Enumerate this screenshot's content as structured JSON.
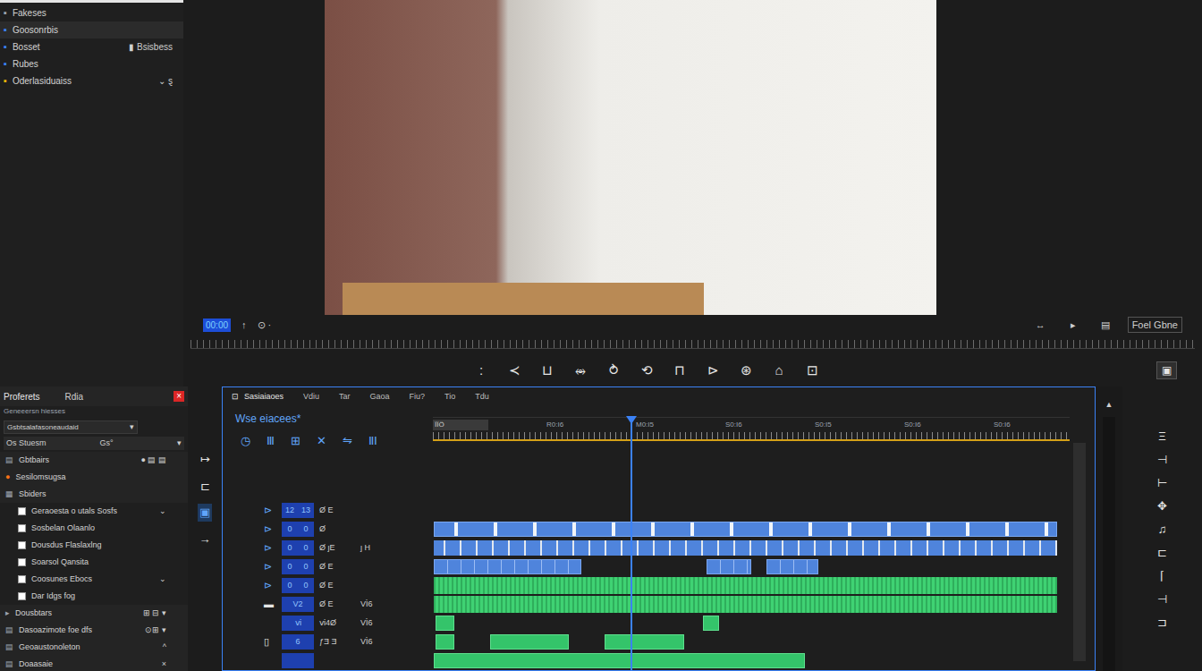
{
  "media_panel": {
    "items": [
      {
        "label": "Fakeses",
        "icon": "▪",
        "secondary": "",
        "color": "#9ca3af",
        "selected": false
      },
      {
        "label": "Goosonrbis",
        "icon": "▪",
        "secondary": "",
        "color": "#3b82f6",
        "selected": true
      },
      {
        "label": "Bosset",
        "icon": "▪",
        "secondary": "▮ Bsisbess",
        "color": "#3b82f6",
        "selected": false
      },
      {
        "label": "Rubes",
        "icon": "▪",
        "secondary": "",
        "color": "#3b82f6",
        "selected": false
      },
      {
        "label": "Oderlasiduaiss",
        "icon": "▪",
        "secondary": "⌄ ȿ",
        "color": "#eab308",
        "selected": false
      }
    ]
  },
  "viewer": {
    "timecode": "00:00",
    "tools": [
      "↑",
      "⊙ ·"
    ],
    "right_icons": [
      "↔",
      "▸",
      "▤"
    ],
    "fit": "Foel Gbne",
    "transport": [
      ":",
      "≺",
      "⊔",
      "⥈",
      "⥁",
      "⟲",
      "⊓",
      "⊳",
      "⊛",
      "⌂",
      "⊡"
    ],
    "end_button": "▣"
  },
  "project_panel": {
    "title": "Proferets",
    "tab": "Rdia",
    "close": "×",
    "subtitle": "Geneeersn hiesses",
    "dropdown": {
      "value": "Gsbtsalafasoneaudaid",
      "arrow": "▾"
    },
    "select_row": {
      "label": "Os Stuesm",
      "value": "Gs°",
      "arrow": "▾"
    },
    "rows": [
      {
        "kind": "row",
        "icon": "▤",
        "label": "Gbtbairs",
        "right": "● ▤ ▤",
        "color": "#9ca3af"
      },
      {
        "kind": "row",
        "icon": "●",
        "label": "Sesilomsugsa",
        "right": "",
        "color": "#f97316"
      },
      {
        "kind": "row",
        "icon": "▦",
        "label": "Sbiders",
        "right": "",
        "color": "#9ca3af"
      },
      {
        "kind": "check",
        "label": "Geraoesta o utals Sosfs",
        "checked": false,
        "right": "⌄"
      },
      {
        "kind": "check",
        "label": "Sosbelan Olaanlo",
        "checked": false,
        "right": ""
      },
      {
        "kind": "check",
        "label": "Dousdus Flaslaxlng",
        "checked": false,
        "right": ""
      },
      {
        "kind": "check",
        "label": "Soarsol Qansita",
        "checked": false,
        "right": ""
      },
      {
        "kind": "check",
        "label": "Coosunes Ebocs",
        "checked": false,
        "right": "⌄"
      },
      {
        "kind": "check",
        "label": "Dar Idgs fog",
        "checked": false,
        "right": ""
      },
      {
        "kind": "row",
        "icon": "▸",
        "label": "Dousbtars",
        "right": "⊞ ⊟ ▾",
        "color": "#9ca3af"
      },
      {
        "kind": "row",
        "icon": "▤",
        "label": "Dasoazimote foe dfs",
        "right": "⊙⊞ ▾",
        "color": "#9ca3af"
      },
      {
        "kind": "row",
        "icon": "▤",
        "label": "Geoaustonoleton",
        "right": "^",
        "color": "#9ca3af"
      },
      {
        "kind": "row",
        "icon": "▤",
        "label": "Doaasaie",
        "right": "×",
        "color": "#9ca3af"
      }
    ]
  },
  "tool_strip": [
    {
      "glyph": "↦",
      "selected": false
    },
    {
      "glyph": "⊏",
      "selected": false
    },
    {
      "glyph": "▣",
      "selected": true
    },
    {
      "glyph": "→",
      "selected": false
    }
  ],
  "timeline": {
    "tab_icon": "⊡",
    "tabs": [
      {
        "label": "Sasiaiaoes",
        "selected": true
      },
      {
        "label": "Vdiu",
        "selected": false
      },
      {
        "label": "Tar",
        "selected": false
      },
      {
        "label": "Gaoa",
        "selected": false
      },
      {
        "label": "Fiu?",
        "selected": false
      },
      {
        "label": "Tio",
        "selected": false
      },
      {
        "label": "Tdu",
        "selected": false
      }
    ],
    "sequence": "Wse eiacees*",
    "tools": [
      "◷",
      "Ⅲ",
      "⊞",
      "✕",
      "⇋",
      "ⅡⅠ"
    ],
    "ruler_labels": [
      "ÏÏÖ",
      "R0:I6",
      "M0:I5",
      "S0:I6",
      "S0:I5",
      "S0:I6",
      "S0:I6"
    ],
    "playhead": {
      "level": 0.31
    },
    "tracks": [
      {
        "toggle": "⊳",
        "cells": [
          "12",
          "13"
        ],
        "label": "Ø E",
        "extra": "",
        "clips": []
      },
      {
        "toggle": "⊳",
        "cells": [
          "0",
          "0"
        ],
        "label": "Ø",
        "extra": "",
        "clips": [
          {
            "kind": "video-markers",
            "start": 0.1,
            "end": 98
          }
        ]
      },
      {
        "toggle": "⊳",
        "cells": [
          "0",
          "0"
        ],
        "label": "Ø ȷE",
        "extra": "ȷ H",
        "clips": [
          {
            "kind": "video-segmented",
            "start": 0.1,
            "end": 98
          }
        ]
      },
      {
        "toggle": "⊳",
        "cells": [
          "0",
          "0"
        ],
        "label": "Ø E",
        "extra": "",
        "clips": [
          {
            "kind": "video",
            "start": 0.1,
            "end": 23.3
          },
          {
            "kind": "video",
            "start": 43,
            "end": 50
          },
          {
            "kind": "video",
            "start": 52.4,
            "end": 60.5
          }
        ]
      },
      {
        "toggle": "⊳",
        "cells": [
          "0",
          "0"
        ],
        "label": "Ø E",
        "extra": "",
        "clips": [
          {
            "kind": "audio-wave",
            "start": 0.1,
            "end": 98
          }
        ]
      },
      {
        "toggle": "▬",
        "cells": [
          "V2"
        ],
        "label": "Ø E",
        "extra": "VÌ6",
        "clips": [
          {
            "kind": "audio-wave",
            "start": 0.1,
            "end": 98
          }
        ]
      },
      {
        "toggle": "",
        "cells": [
          "ⅵ"
        ],
        "label": "ⅵ4Ø",
        "extra": "VÌ6",
        "clips": [
          {
            "kind": "audio",
            "start": 0.4,
            "end": 3.4
          },
          {
            "kind": "audio",
            "start": 42.4,
            "end": 45
          }
        ]
      },
      {
        "toggle": "▯",
        "cells": [
          "6"
        ],
        "label": "ƒƎ Ǝ",
        "extra": "VÌ6",
        "clips": [
          {
            "kind": "audio",
            "start": 0.4,
            "end": 3.4
          },
          {
            "kind": "audio",
            "start": 9,
            "end": 21.3
          },
          {
            "kind": "audio",
            "start": 26.9,
            "end": 39.5
          }
        ]
      },
      {
        "toggle": "",
        "cells": [],
        "label": "",
        "extra": "",
        "clips": [
          {
            "kind": "audio",
            "start": 0.1,
            "end": 58.4
          }
        ]
      }
    ]
  },
  "right_panel": {
    "scroll_icon": "▲",
    "icons": [
      "Ξ",
      "⊣",
      "⊢",
      "✥",
      "♫",
      "⊏",
      "⌈",
      "⊣",
      "⊐"
    ]
  }
}
